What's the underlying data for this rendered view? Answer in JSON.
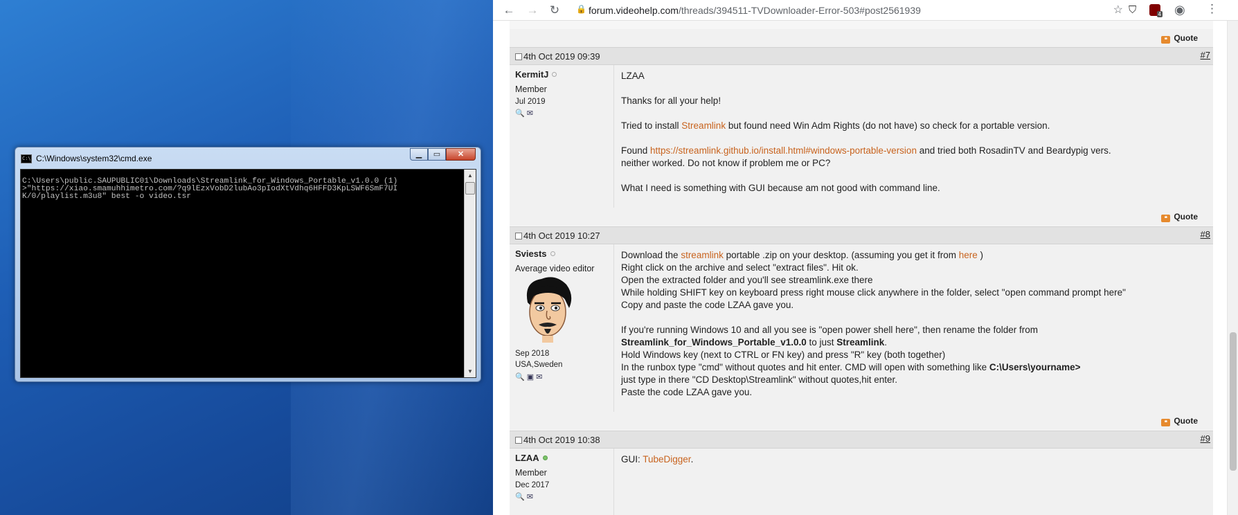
{
  "cmd": {
    "title": "C:\\Windows\\system32\\cmd.exe",
    "lines": [
      "C:\\Users\\public.SAUPUBLIC01\\Downloads\\Streamlink_for_Windows_Portable_v1.0.0 (1)",
      ">\"https://xiao.smamuhhimetro.com/?q9lEzxVobD2lubAo3pIodXtVdhq6HFFD3KpLSWF6SmF7UI",
      "K/0/playlist.m3u8\" best -o video.tsr"
    ]
  },
  "browser": {
    "url_host": "forum.videohelp.com",
    "url_path": "/threads/394511-TVDownloader-Error-503#post2561939",
    "ext_badge": "4"
  },
  "quote_label": "Quote",
  "posts": [
    {
      "date": "4th Oct 2019 09:39",
      "num": "#7",
      "user": "KermitJ",
      "role": "Member",
      "joined": "Jul 2019",
      "l1": "LZAA",
      "l2": "Thanks for all your help!",
      "l3a": "Tried to install ",
      "l3link": "Streamlink",
      "l3b": " but found need Win Adm Rights (do not have) so check for a portable version.",
      "l4a": "Found ",
      "l4link": "https://streamlink.github.io/install.html#windows-portable-version",
      "l4b": " and tried both RosadinTV and Beardypig vers.",
      "l5": "neither worked. Do not know if problem me or PC?",
      "l6": "What I need is something with GUI because am not good with command line."
    },
    {
      "date": "4th Oct 2019 10:27",
      "num": "#8",
      "user": "Sviests",
      "role": "Average video editor",
      "joined": "Sep 2018",
      "location": "USA,Sweden",
      "l1a": "Download the ",
      "l1link": "streamlink",
      "l1b": " portable .zip on your desktop. (assuming you get it from ",
      "l1link2": "here",
      "l1c": " )",
      "l2": "Right click on the archive and select \"extract files\". Hit ok.",
      "l3": "Open the extracted folder and you'll see streamlink.exe there",
      "l4": "While holding SHIFT key on keyboard press right mouse click anywhere in the folder, select \"open command prompt here\"",
      "l5": "Copy and paste the code LZAA gave you.",
      "l6": "If you're running Windows 10 and all you see is \"open power shell here\", then rename the folder from",
      "l7a": "Streamlink_for_Windows_Portable_v1.0.0",
      "l7b": " to just ",
      "l7c": "Streamlink",
      "l7d": ".",
      "l8": "Hold Windows key (next to CTRL or FN key) and press \"R\" key (both together)",
      "l9a": "In the runbox type \"cmd\" without quotes and hit enter. CMD will open with something like ",
      "l9b": "C:\\Users\\yourname>",
      "l10": "just type in there \"CD Desktop\\Streamlink\" without quotes,hit enter.",
      "l11": "Paste the code LZAA gave you."
    },
    {
      "date": "4th Oct 2019 10:38",
      "num": "#9",
      "user": "LZAA",
      "role": "Member",
      "joined": "Dec 2017",
      "l1a": "GUI: ",
      "l1link": "TubeDigger",
      "l1b": "."
    }
  ]
}
